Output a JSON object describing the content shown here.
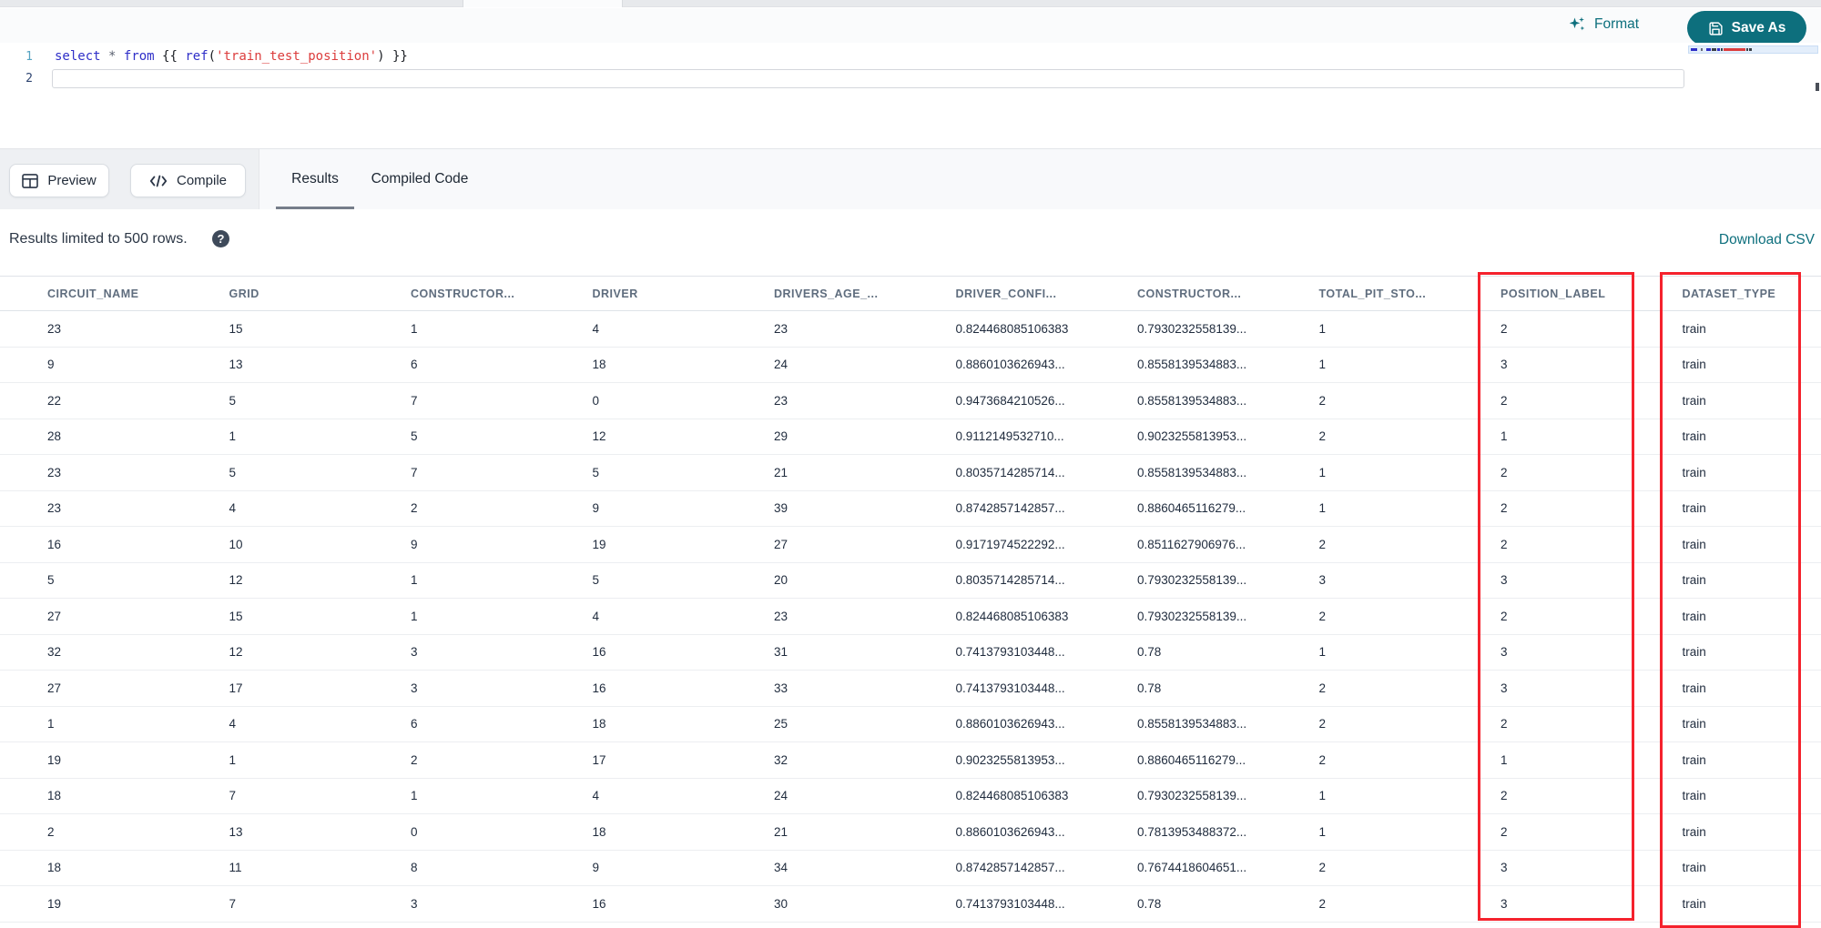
{
  "toolbar_top": {
    "format_label": "Format",
    "save_as_label": "Save As"
  },
  "editor": {
    "line_numbers": [
      "1",
      "2"
    ],
    "code_line": {
      "tokens": [
        {
          "text": "select",
          "type": "keyword"
        },
        {
          "text": " ",
          "type": "plain"
        },
        {
          "text": "*",
          "type": "operator"
        },
        {
          "text": " ",
          "type": "plain"
        },
        {
          "text": "from",
          "type": "keyword"
        },
        {
          "text": " {{ ",
          "type": "plain"
        },
        {
          "text": "ref",
          "type": "function"
        },
        {
          "text": "(",
          "type": "plain"
        },
        {
          "text": "'train_test_position'",
          "type": "string"
        },
        {
          "text": ")",
          "type": "plain"
        },
        {
          "text": " }}",
          "type": "plain"
        }
      ]
    }
  },
  "actions_bar": {
    "preview_label": "Preview",
    "compile_label": "Compile",
    "tabs": [
      {
        "label": "Results",
        "active": true
      },
      {
        "label": "Compiled Code",
        "active": false
      }
    ]
  },
  "results_bar": {
    "limit_note": "Results limited to 500 rows.",
    "help_icon": "?",
    "download_label": "Download CSV"
  },
  "table": {
    "columns": [
      "CIRCUIT_NAME",
      "GRID",
      "CONSTRUCTOR...",
      "DRIVER",
      "DRIVERS_AGE_...",
      "DRIVER_CONFI...",
      "CONSTRUCTOR...",
      "TOTAL_PIT_STO...",
      "POSITION_LABEL",
      "DATASET_TYPE"
    ],
    "highlighted_columns": [
      "POSITION_LABEL",
      "DATASET_TYPE"
    ],
    "rows": [
      [
        "23",
        "15",
        "1",
        "4",
        "23",
        "0.824468085106383",
        "0.7930232558139...",
        "1",
        "2",
        "train"
      ],
      [
        "9",
        "13",
        "6",
        "18",
        "24",
        "0.8860103626943...",
        "0.8558139534883...",
        "1",
        "3",
        "train"
      ],
      [
        "22",
        "5",
        "7",
        "0",
        "23",
        "0.9473684210526...",
        "0.8558139534883...",
        "2",
        "2",
        "train"
      ],
      [
        "28",
        "1",
        "5",
        "12",
        "29",
        "0.9112149532710...",
        "0.9023255813953...",
        "2",
        "1",
        "train"
      ],
      [
        "23",
        "5",
        "7",
        "5",
        "21",
        "0.8035714285714...",
        "0.8558139534883...",
        "1",
        "2",
        "train"
      ],
      [
        "23",
        "4",
        "2",
        "9",
        "39",
        "0.8742857142857...",
        "0.8860465116279...",
        "1",
        "2",
        "train"
      ],
      [
        "16",
        "10",
        "9",
        "19",
        "27",
        "0.9171974522292...",
        "0.8511627906976...",
        "2",
        "2",
        "train"
      ],
      [
        "5",
        "12",
        "1",
        "5",
        "20",
        "0.8035714285714...",
        "0.7930232558139...",
        "3",
        "3",
        "train"
      ],
      [
        "27",
        "15",
        "1",
        "4",
        "23",
        "0.824468085106383",
        "0.7930232558139...",
        "2",
        "2",
        "train"
      ],
      [
        "32",
        "12",
        "3",
        "16",
        "31",
        "0.7413793103448...",
        "0.78",
        "1",
        "3",
        "train"
      ],
      [
        "27",
        "17",
        "3",
        "16",
        "33",
        "0.7413793103448...",
        "0.78",
        "2",
        "3",
        "train"
      ],
      [
        "1",
        "4",
        "6",
        "18",
        "25",
        "0.8860103626943...",
        "0.8558139534883...",
        "2",
        "2",
        "train"
      ],
      [
        "19",
        "1",
        "2",
        "17",
        "32",
        "0.9023255813953...",
        "0.8860465116279...",
        "2",
        "1",
        "train"
      ],
      [
        "18",
        "7",
        "1",
        "4",
        "24",
        "0.824468085106383",
        "0.7930232558139...",
        "1",
        "2",
        "train"
      ],
      [
        "2",
        "13",
        "0",
        "18",
        "21",
        "0.8860103626943...",
        "0.7813953488372...",
        "1",
        "2",
        "train"
      ],
      [
        "18",
        "11",
        "8",
        "9",
        "34",
        "0.8742857142857...",
        "0.7674418604651...",
        "2",
        "3",
        "train"
      ],
      [
        "19",
        "7",
        "3",
        "16",
        "30",
        "0.7413793103448...",
        "0.78",
        "2",
        "3",
        "train"
      ]
    ]
  },
  "colors": {
    "accent_teal": "#0d6f7d",
    "annotation_red": "#f5222d",
    "keyword_blue": "#2f2fc8",
    "string_red": "#dc3d3d"
  }
}
